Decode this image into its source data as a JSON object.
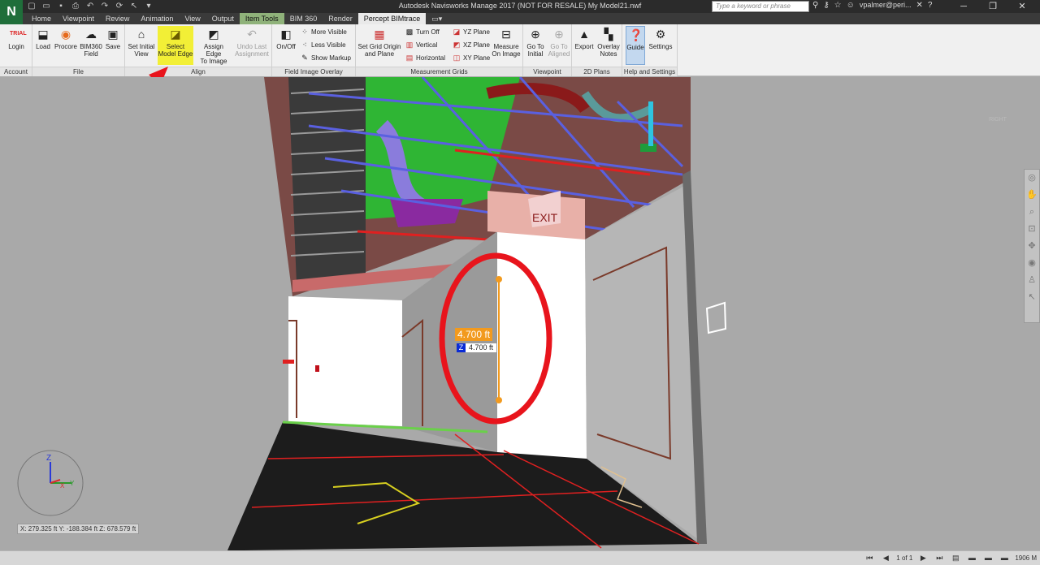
{
  "app": {
    "logo_letter": "N",
    "window_title": "Autodesk Navisworks Manage 2017 (NOT FOR RESALE)    My Model21.nwf",
    "search_placeholder": "Type a keyword or phrase",
    "user": "vpalmer@peri..."
  },
  "tabs": [
    "Home",
    "Viewpoint",
    "Review",
    "Animation",
    "View",
    "Output",
    "Item Tools",
    "BIM 360",
    "Render",
    "Percept BIMtrace"
  ],
  "ribbon": {
    "account": {
      "label": "Account",
      "login": "Login",
      "trial": "TRIAL"
    },
    "file": {
      "label": "File",
      "load": "Load",
      "procore": "Procore",
      "bim360_line1": "BIM360",
      "bim360_line2": "Field",
      "save": "Save"
    },
    "align": {
      "label": "Align",
      "set_initial_line1": "Set Initial",
      "set_initial_line2": "View",
      "select_edge_line1": "Select",
      "select_edge_line2": "Model Edge",
      "assign_edge_line1": "Assign Edge",
      "assign_edge_line2": "To Image",
      "undo_line1": "Undo Last",
      "undo_line2": "Assignment"
    },
    "overlay": {
      "label": "Field Image Overlay",
      "onoff": "On/Off",
      "more_visible": "More Visible",
      "less_visible": "Less Visible",
      "show_markup": "Show Markup"
    },
    "grids": {
      "label": "Measurement Grids",
      "set_grid_line1": "Set Grid Origin",
      "set_grid_line2": "and Plane",
      "turn_off": "Turn Off",
      "vertical": "Vertical",
      "horizontal": "Horizontal",
      "yz_plane": "YZ Plane",
      "xz_plane": "XZ Plane",
      "xy_plane": "XY Plane",
      "measure_line1": "Measure",
      "measure_line2": "On Image"
    },
    "viewpoint": {
      "label": "Viewpoint",
      "go_initial_line1": "Go To",
      "go_initial_line2": "Initial",
      "go_aligned_line1": "Go To",
      "go_aligned_line2": "Aligned"
    },
    "plans": {
      "label": "2D Plans",
      "export": "Export",
      "overlay_line1": "Overlay",
      "overlay_line2": "Notes"
    },
    "help": {
      "label": "Help and Settings",
      "guide": "Guide",
      "settings": "Settings"
    }
  },
  "viewport": {
    "measure_value": "4.700 ft",
    "measure_axis": "Z",
    "measure_z_value": "4.700 ft",
    "coordinates": "X: 279.325 ft  Y: -188.384 ft  Z: 678.579 ft",
    "exit_sign": "EXIT",
    "viewcube_label": "RIGHT",
    "axis_z": "Z",
    "axis_y": "Y",
    "axis_x": "X"
  },
  "status": {
    "page": "1 of 1",
    "memory": "1906 M"
  },
  "colors": {
    "highlight_button": "#f2ef36",
    "annotation_red": "#e8141c",
    "measure_orange": "#f29a1e",
    "item_tools_tab": "#8fb27a"
  }
}
